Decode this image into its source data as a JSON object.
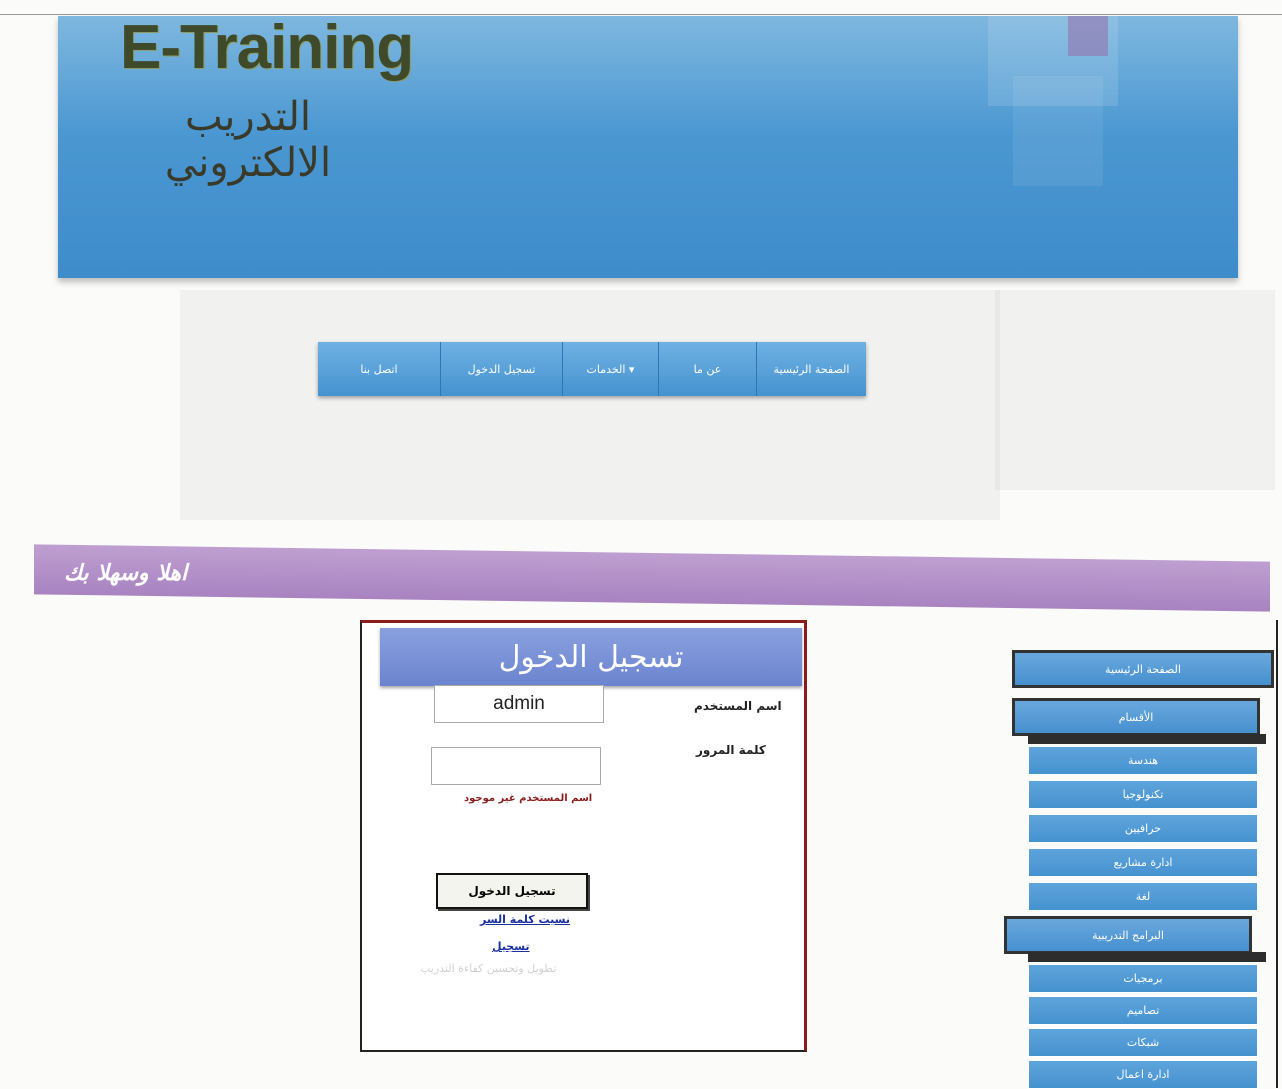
{
  "header": {
    "logo_en": "E-Training",
    "logo_ar": "التدريب الالكتروني"
  },
  "nav": {
    "items": [
      {
        "label": "الصفحة الرئيسية"
      },
      {
        "label": "عن ما"
      },
      {
        "label": "▾ الخدمات"
      },
      {
        "label": "تسجيل الدخول"
      },
      {
        "label": "اتصل بنا"
      }
    ]
  },
  "welcome": {
    "text": "اهلا وسهلا بك"
  },
  "login": {
    "title": "تسجيل الدخول",
    "username_label": "اسم المستخدم",
    "username_value": "admin",
    "password_label": "كلمة المرور",
    "password_value": "",
    "error": "اسم المستخدم غير موجود",
    "submit": "تسجيل الدخول",
    "forgot": "نسيت كلمة السر",
    "register": "تسجيل"
  },
  "sidebar": {
    "home": "الصفحة الرئيسية",
    "departments": "الأقسام",
    "department_items": [
      "هندسة",
      "تكنولوجيا",
      "حرافيين",
      "ادارة مشاريع",
      "لغة"
    ],
    "programs": "البرامج التدريبية",
    "program_items": [
      "برمجيات",
      "تصاميم",
      "شبكات",
      "ادارة اعمال"
    ]
  },
  "colors": {
    "banner_blue": "#4b98d2",
    "welcome_purple": "#b593c9",
    "login_header": "#7b92d7",
    "error_red": "#8b1c1c"
  }
}
